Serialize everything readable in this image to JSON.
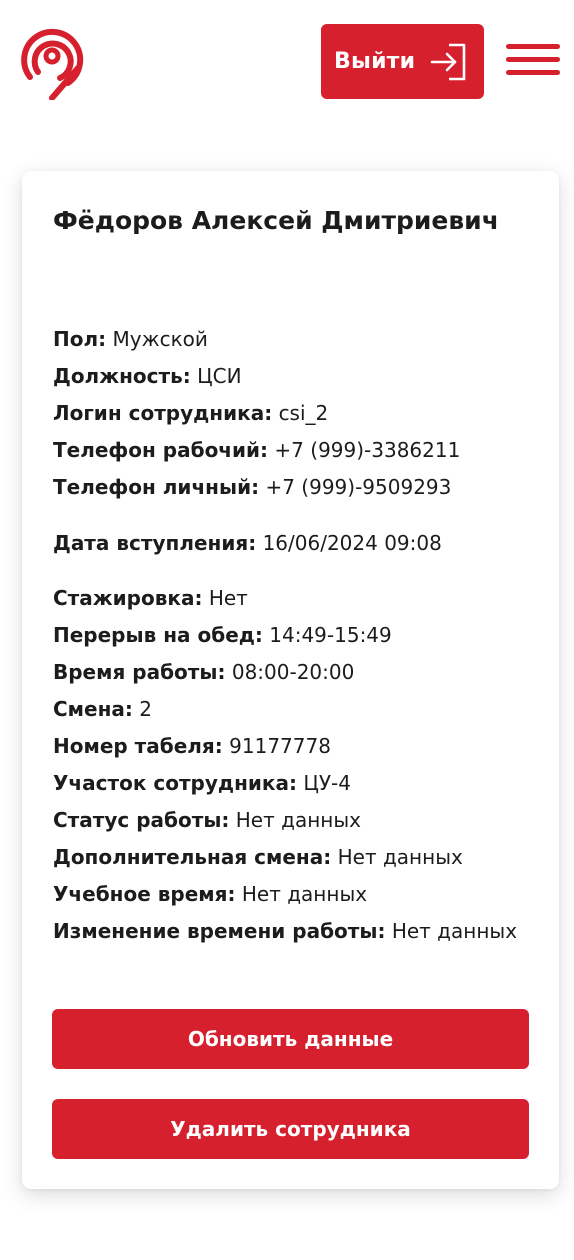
{
  "header": {
    "logout_label": "Выйти",
    "accent_color": "#d6202e",
    "logo_icon": "location-pin-logo-icon",
    "logout_icon": "logout-arrow-icon",
    "menu_icon": "hamburger-menu-icon"
  },
  "employee": {
    "name": "Фёдоров Алексей Дмитриевич",
    "fields": [
      {
        "label": "Пол:",
        "value": "Мужской"
      },
      {
        "label": "Должность:",
        "value": "ЦСИ"
      },
      {
        "label": "Логин сотрудника:",
        "value": "csi_2"
      },
      {
        "label": "Телефон рабочий:",
        "value": "+7 (999)-3386211"
      },
      {
        "label": "Телефон личный:",
        "value": "+7 (999)-9509293"
      },
      {
        "label": "Дата вступления:",
        "value": "16/06/2024 09:08"
      },
      {
        "label": "Стажировка:",
        "value": "Нет"
      },
      {
        "label": "Перерыв на обед:",
        "value": "14:49-15:49"
      },
      {
        "label": "Время работы:",
        "value": "08:00-20:00"
      },
      {
        "label": "Смена:",
        "value": "2"
      },
      {
        "label": "Номер табеля:",
        "value": "91177778"
      },
      {
        "label": "Участок сотрудника:",
        "value": "ЦУ-4"
      },
      {
        "label": "Статус работы:",
        "value": "Нет данных"
      },
      {
        "label": "Дополнительная смена:",
        "value": "Нет данных"
      },
      {
        "label": "Учебное время:",
        "value": "Нет данных"
      },
      {
        "label": "Изменение времени работы:",
        "value": "Нет данных"
      }
    ]
  },
  "actions": {
    "update_label": "Обновить данные",
    "delete_label": "Удалить сотрудника"
  }
}
